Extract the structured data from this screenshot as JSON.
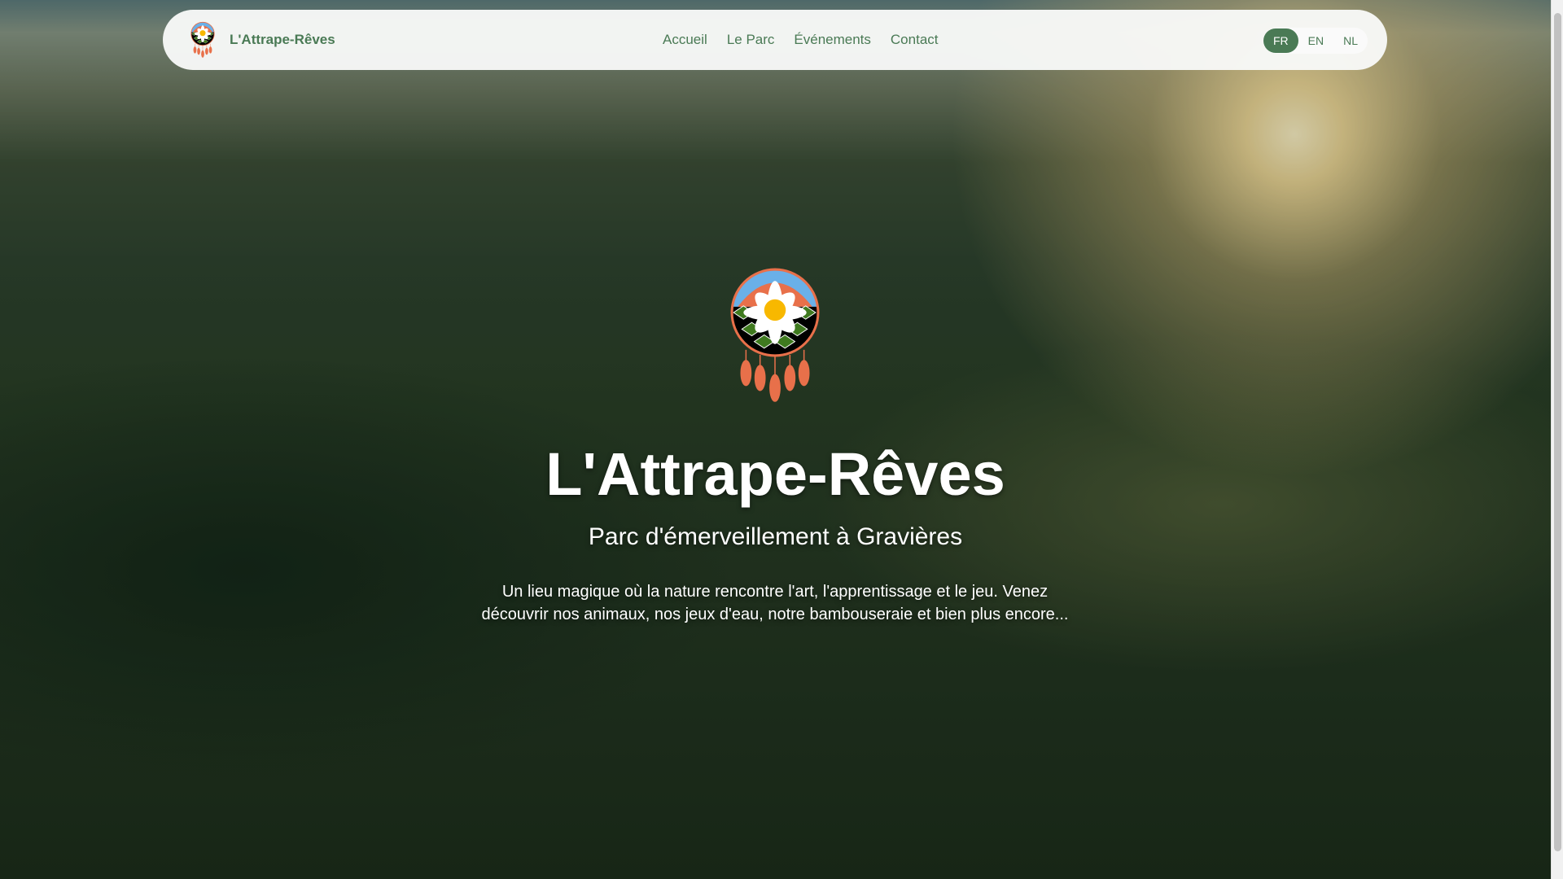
{
  "nav": {
    "brand": "L'Attrape-Rêves",
    "links": [
      "Accueil",
      "Le Parc",
      "Événements",
      "Contact"
    ],
    "languages": [
      "FR",
      "EN",
      "NL"
    ],
    "active_language": "FR"
  },
  "hero": {
    "title": "L'Attrape-Rêves",
    "subtitle": "Parc d'émerveillement à Gravières",
    "description": "Un lieu magique où la nature rencontre l'art, l'apprentissage et le jeu. Venez découvrir nos animaux, nos jeux d'eau, notre bambouseraie et bien plus encore...",
    "logo_text": "L'ATTRAPE-RÊVES"
  },
  "colors": {
    "accent": "#4a7a55",
    "feather": "#e8704a",
    "sky": "#6ab0e8",
    "leaf": "#3f7a1f",
    "sun": "#f8b800"
  }
}
